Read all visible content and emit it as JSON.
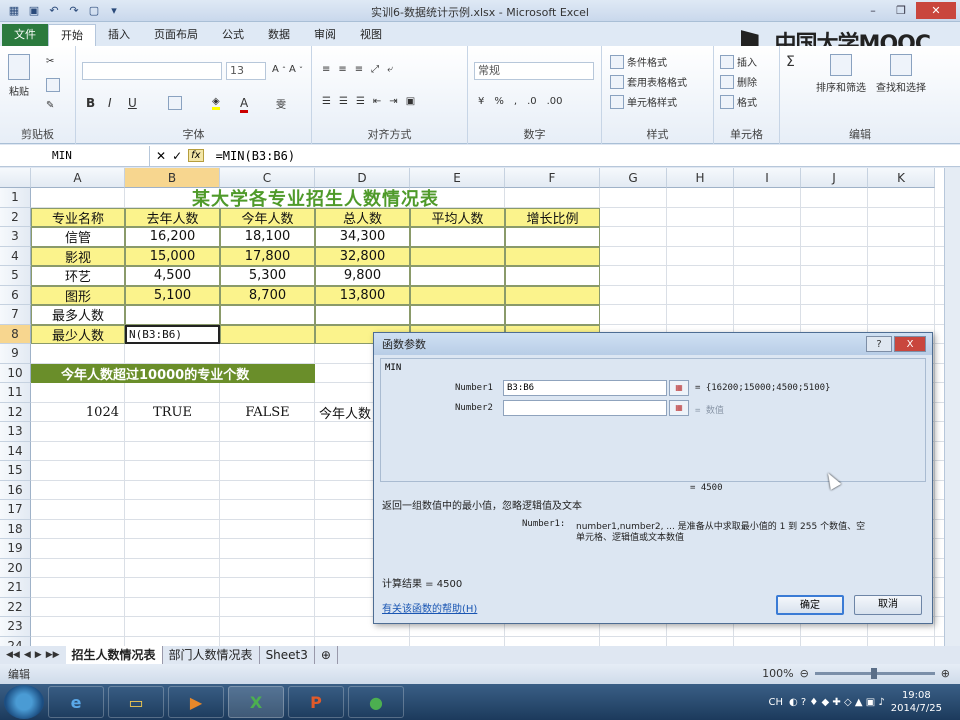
{
  "window": {
    "title": "实训6-数据统计示例.xlsx - Microsoft Excel",
    "watermark": "中国大学MOOC"
  },
  "ribbon": {
    "tabs": [
      "文件",
      "开始",
      "插入",
      "页面布局",
      "公式",
      "数据",
      "审阅",
      "视图"
    ],
    "active_tab": "开始",
    "groups": {
      "clipboard": {
        "label": "剪贴板",
        "paste": "粘贴"
      },
      "font": {
        "label": "字体",
        "size": "13",
        "bold": "B",
        "italic": "I",
        "underline": "U"
      },
      "alignment": {
        "label": "对齐方式"
      },
      "number": {
        "label": "数字",
        "format": "常规",
        "percent": "%"
      },
      "styles": {
        "label": "样式",
        "conditional": "条件格式",
        "table": "套用表格格式",
        "cell": "单元格样式"
      },
      "cells": {
        "label": "单元格",
        "insert": "插入",
        "delete": "删除",
        "format": "格式"
      },
      "editing": {
        "label": "编辑",
        "sort": "排序和筛选",
        "find": "查找和选择"
      }
    }
  },
  "formula_bar": {
    "name_box": "MIN",
    "formula": "=MIN(B3:B6)"
  },
  "columns": [
    "A",
    "B",
    "C",
    "D",
    "E",
    "F",
    "G",
    "H",
    "I",
    "J",
    "K"
  ],
  "rows": [
    "1",
    "2",
    "3",
    "4",
    "5",
    "6",
    "7",
    "8",
    "9",
    "10",
    "11",
    "12",
    "13",
    "14",
    "15",
    "16",
    "17",
    "18",
    "19",
    "20",
    "21",
    "22",
    "23",
    "24"
  ],
  "sheet": {
    "title": "某大学各专业招生人数情况表",
    "headers": [
      "专业名称",
      "去年人数",
      "今年人数",
      "总人数",
      "平均人数",
      "增长比例"
    ],
    "data": [
      [
        "信管",
        "16,200",
        "18,100",
        "34,300"
      ],
      [
        "影视",
        "15,000",
        "17,800",
        "32,800"
      ],
      [
        "环艺",
        "4,500",
        "5,300",
        "9,800"
      ],
      [
        "图形",
        "5,100",
        "8,700",
        "13,800"
      ]
    ],
    "row7_label": "最多人数",
    "row8_label": "最少人数",
    "row8_edit": "N(B3:B6)",
    "banner": "今年人数超过10000的专业个数",
    "r12": [
      "1024",
      "TRUE",
      "FALSE",
      "今年人数"
    ]
  },
  "sheet_tabs": [
    "招生人数情况表",
    "部门人数情况表",
    "Sheet3"
  ],
  "status": {
    "mode": "编辑",
    "zoom": "100%"
  },
  "dialog": {
    "title": "函数参数",
    "help_btn": "?",
    "close_btn": "X",
    "func": "MIN",
    "arg1_label": "Number1",
    "arg1_value": "B3:B6",
    "arg1_result": "= {16200;15000;4500;5100}",
    "arg2_label": "Number2",
    "arg2_result": "= 数值",
    "total": "= 4500",
    "description": "返回一组数值中的最小值，忽略逻辑值及文本",
    "arg_help_label": "Number1:",
    "arg_help_text": "number1,number2, ... 是准备从中求取最小值的 1 到 255 个数值、空",
    "arg_help_text2": "单元格、逻辑值或文本数值",
    "calc_result": "计算结果 =  4500",
    "help_link": "有关该函数的帮助(H)",
    "ok": "确定",
    "cancel": "取消"
  },
  "taskbar": {
    "time": "19:08",
    "date": "2014/7/25",
    "lang": "CH"
  }
}
